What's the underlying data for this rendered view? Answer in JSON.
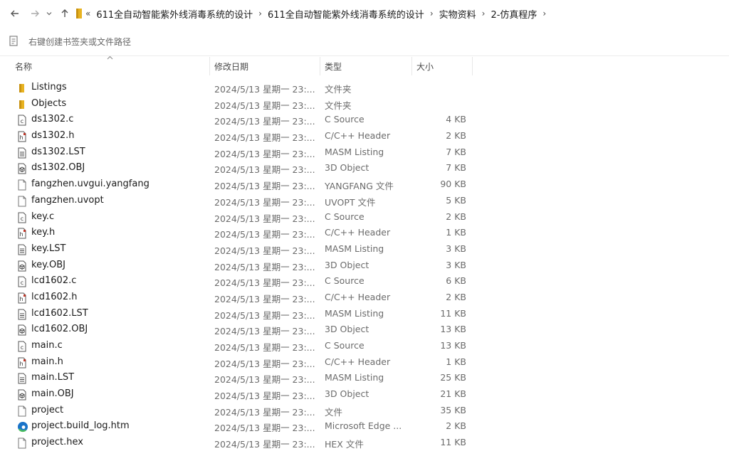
{
  "breadcrumbs": [
    "611全自动智能紫外线消毒系统的设计",
    "611全自动智能紫外线消毒系统的设计",
    "实物资料",
    "2-仿真程序"
  ],
  "overflow_marker": "«",
  "favorites_bar_text": "右键创建书签夹或文件路径",
  "columns": {
    "name": "名称",
    "date": "修改日期",
    "type": "类型",
    "size": "大小"
  },
  "files": [
    {
      "name": "Listings",
      "date": "2024/5/13 星期一 23:...",
      "type": "文件夹",
      "size": "",
      "icon": "folder-icon"
    },
    {
      "name": "Objects",
      "date": "2024/5/13 星期一 23:...",
      "type": "文件夹",
      "size": "",
      "icon": "folder-icon"
    },
    {
      "name": "ds1302.c",
      "date": "2024/5/13 星期一 23:...",
      "type": "C Source",
      "size": "4 KB",
      "icon": "c-source-icon"
    },
    {
      "name": "ds1302.h",
      "date": "2024/5/13 星期一 23:...",
      "type": "C/C++ Header",
      "size": "2 KB",
      "icon": "header-file-icon"
    },
    {
      "name": "ds1302.LST",
      "date": "2024/5/13 星期一 23:...",
      "type": "MASM Listing",
      "size": "7 KB",
      "icon": "listing-file-icon"
    },
    {
      "name": "ds1302.OBJ",
      "date": "2024/5/13 星期一 23:...",
      "type": "3D Object",
      "size": "7 KB",
      "icon": "3d-object-icon"
    },
    {
      "name": "fangzhen.uvgui.yangfang",
      "date": "2024/5/13 星期一 23:...",
      "type": "YANGFANG 文件",
      "size": "90 KB",
      "icon": "blank-file-icon"
    },
    {
      "name": "fangzhen.uvopt",
      "date": "2024/5/13 星期一 23:...",
      "type": "UVOPT 文件",
      "size": "5 KB",
      "icon": "blank-file-icon"
    },
    {
      "name": "key.c",
      "date": "2024/5/13 星期一 23:...",
      "type": "C Source",
      "size": "2 KB",
      "icon": "c-source-icon"
    },
    {
      "name": "key.h",
      "date": "2024/5/13 星期一 23:...",
      "type": "C/C++ Header",
      "size": "1 KB",
      "icon": "header-file-icon"
    },
    {
      "name": "key.LST",
      "date": "2024/5/13 星期一 23:...",
      "type": "MASM Listing",
      "size": "3 KB",
      "icon": "listing-file-icon"
    },
    {
      "name": "key.OBJ",
      "date": "2024/5/13 星期一 23:...",
      "type": "3D Object",
      "size": "3 KB",
      "icon": "3d-object-icon"
    },
    {
      "name": "lcd1602.c",
      "date": "2024/5/13 星期一 23:...",
      "type": "C Source",
      "size": "6 KB",
      "icon": "c-source-icon"
    },
    {
      "name": "lcd1602.h",
      "date": "2024/5/13 星期一 23:...",
      "type": "C/C++ Header",
      "size": "2 KB",
      "icon": "header-file-icon"
    },
    {
      "name": "lcd1602.LST",
      "date": "2024/5/13 星期一 23:...",
      "type": "MASM Listing",
      "size": "11 KB",
      "icon": "listing-file-icon"
    },
    {
      "name": "lcd1602.OBJ",
      "date": "2024/5/13 星期一 23:...",
      "type": "3D Object",
      "size": "13 KB",
      "icon": "3d-object-icon"
    },
    {
      "name": "main.c",
      "date": "2024/5/13 星期一 23:...",
      "type": "C Source",
      "size": "13 KB",
      "icon": "c-source-icon"
    },
    {
      "name": "main.h",
      "date": "2024/5/13 星期一 23:...",
      "type": "C/C++ Header",
      "size": "1 KB",
      "icon": "header-file-icon"
    },
    {
      "name": "main.LST",
      "date": "2024/5/13 星期一 23:...",
      "type": "MASM Listing",
      "size": "25 KB",
      "icon": "listing-file-icon"
    },
    {
      "name": "main.OBJ",
      "date": "2024/5/13 星期一 23:...",
      "type": "3D Object",
      "size": "21 KB",
      "icon": "3d-object-icon"
    },
    {
      "name": "project",
      "date": "2024/5/13 星期一 23:...",
      "type": "文件",
      "size": "35 KB",
      "icon": "blank-file-icon"
    },
    {
      "name": "project.build_log.htm",
      "date": "2024/5/13 星期一 23:...",
      "type": "Microsoft Edge ...",
      "size": "2 KB",
      "icon": "edge-icon"
    },
    {
      "name": "project.hex",
      "date": "2024/5/13 星期一 23:...",
      "type": "HEX 文件",
      "size": "11 KB",
      "icon": "blank-file-icon"
    }
  ],
  "colors": {
    "folder": "#e8b321",
    "edge_blue": "#1a73c9",
    "edge_green": "#4cbf5a"
  }
}
